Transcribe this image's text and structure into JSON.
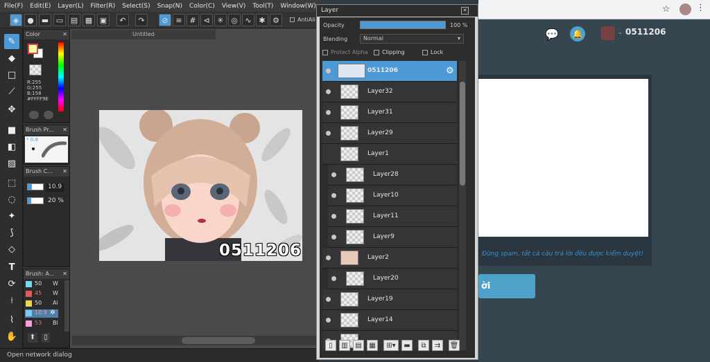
{
  "menu": [
    "File(F)",
    "Edit(E)",
    "Layer(L)",
    "Filter(R)",
    "Select(S)",
    "Snap(N)",
    "Color(C)",
    "View(V)",
    "Tool(T)",
    "Window(W)"
  ],
  "toolbar": {
    "antialias_label": "AntiAli"
  },
  "document": {
    "tab_title": "Untitled"
  },
  "color_panel": {
    "title": "Color",
    "r": "R:255",
    "g": "G:255",
    "b": "B:158",
    "hex": "#FFFF9E",
    "fg": "#ffff9e"
  },
  "brush_preview": {
    "title": "Brush Pr...",
    "size_label": "* 0.9"
  },
  "brush_control": {
    "title": "Brush C...",
    "size": "10.9",
    "opacity": "20 %"
  },
  "brush_list": {
    "title": "Brush: A...",
    "items": [
      {
        "size": "50",
        "name": "W",
        "color": "#78d7f0"
      },
      {
        "size": "45",
        "name": "W",
        "color": "#e05a5a"
      },
      {
        "size": "50",
        "name": "Ai",
        "color": "#e8d84a"
      },
      {
        "size": "10.9",
        "name": "",
        "color": "#7ec8f0"
      },
      {
        "size": "53",
        "name": "Bl",
        "color": "#f5a0d8"
      }
    ]
  },
  "artwork": {
    "watermark": "0511206"
  },
  "layer_window": {
    "title": "Layer",
    "opacity_label": "Opacity",
    "opacity_value": "100 %",
    "blending_label": "Blending",
    "blending_value": "Normal",
    "protect_alpha": "Protect Alpha",
    "clipping": "Clipping",
    "lock": "Lock",
    "layers": [
      {
        "name": "0511206",
        "selected": true,
        "indent": false
      },
      {
        "name": "Layer32",
        "selected": false,
        "indent": false
      },
      {
        "name": "Layer31",
        "selected": false,
        "indent": false
      },
      {
        "name": "Layer29",
        "selected": false,
        "indent": false
      },
      {
        "name": "Layer1",
        "selected": false,
        "indent": false
      },
      {
        "name": "Layer28",
        "selected": false,
        "indent": true
      },
      {
        "name": "Layer10",
        "selected": false,
        "indent": true
      },
      {
        "name": "Layer11",
        "selected": false,
        "indent": true
      },
      {
        "name": "Layer9",
        "selected": false,
        "indent": true
      },
      {
        "name": "Layer2",
        "selected": false,
        "indent": false
      },
      {
        "name": "Layer20",
        "selected": false,
        "indent": true
      },
      {
        "name": "Layer19",
        "selected": false,
        "indent": false
      },
      {
        "name": "Layer14",
        "selected": false,
        "indent": false
      }
    ]
  },
  "status": {
    "text": "Open network dialog"
  },
  "browser": {
    "username": "0511206",
    "notice": "Đừng spam, tất cả câu trả lời đều được kiểm duyệt!",
    "submit_partial": "ời",
    "accent": "#4ea1c8"
  }
}
